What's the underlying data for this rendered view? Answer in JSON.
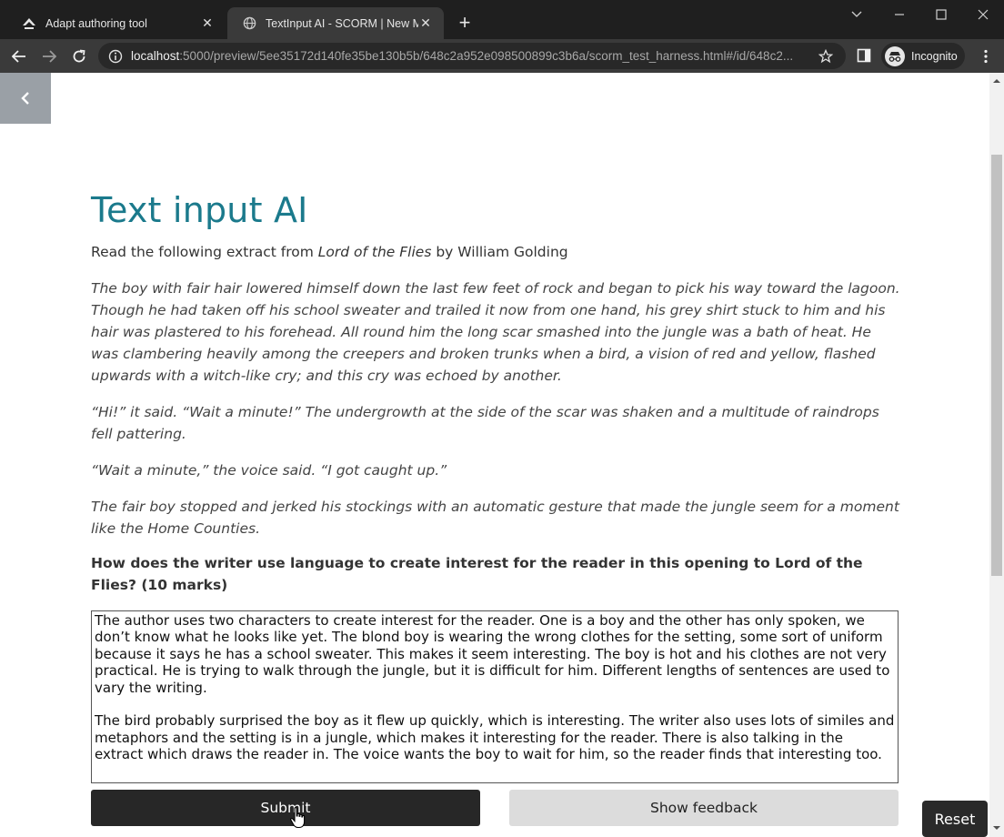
{
  "browser": {
    "tabs": [
      {
        "title": "Adapt authoring tool",
        "icon": "adapt-logo-icon"
      },
      {
        "title": "TextInput AI - SCORM | New Men",
        "icon": "globe-icon"
      }
    ],
    "url_host": "localhost",
    "url_path": ":5000/preview/5ee35172d140fe35be130b5b/648c2a952e098500899c3b6a/scorm_test_harness.html#/id/648c2...",
    "incognito_label": "Incognito"
  },
  "page": {
    "title": "Text input AI",
    "intro_prefix": "Read the following extract from ",
    "intro_book": "Lord of the Flies",
    "intro_suffix": " by William Golding",
    "extract": [
      "The boy with fair hair lowered himself down the last few feet of rock and began to pick his way toward the lagoon. Though he had taken off his school sweater and trailed it now from one hand, his grey shirt stuck to him and his hair was plastered to his forehead. All round him the long scar smashed into the jungle was a bath of heat. He was clambering heavily among the creepers and broken trunks when a bird, a vision of red and yellow, flashed upwards with a witch-like cry; and this cry was echoed by another.",
      "“Hi!” it said. “Wait a minute!” The undergrowth at the side of the scar was shaken and a multitude of raindrops fell pattering.",
      "“Wait a minute,” the voice said. “I got caught up.”",
      "The fair boy stopped and jerked his stockings with an automatic gesture that made the jungle seem for a moment like the Home Counties."
    ],
    "question": "How does the writer use language to create interest for the reader in this opening to Lord of the Flies? (10 marks)",
    "answer": "The author uses two characters to create interest for the reader. One is a boy and the other has only spoken, we don’t know what he looks like yet. The blond boy is wearing the wrong clothes for the setting, some sort of uniform because it says he has a school sweater. This makes it seem interesting. The boy is hot and his clothes are not very practical. He is trying to walk through the jungle, but it is difficult for him. Different lengths of sentences are used to vary the writing.\n\nThe bird probably surprised the boy as it flew up quickly, which is interesting. The writer also uses lots of similes and metaphors and the setting is in a jungle, which makes it interesting for the reader. There is also talking in the extract which draws the reader in. The voice wants the boy to wait for him, so the reader finds that interesting too.",
    "submit_label": "Submit",
    "feedback_label": "Show feedback",
    "reset_label": "Reset"
  },
  "colors": {
    "title": "#1b7a8c",
    "submit_bg": "#272727",
    "feedback_bg": "#dcdcdc",
    "back_button_bg": "#9aa0a6"
  }
}
